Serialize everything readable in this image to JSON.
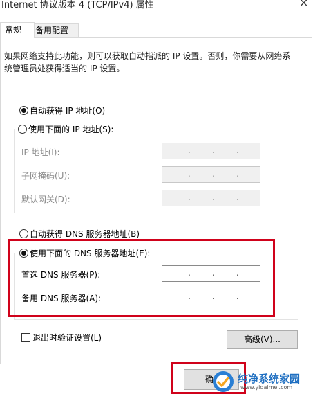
{
  "window": {
    "title": "Internet 协议版本 4 (TCP/IPv4) 属性",
    "close_glyph": "×"
  },
  "tabs": [
    {
      "label": "常规",
      "active": true
    },
    {
      "label": "备用配置",
      "active": false
    }
  ],
  "description": "如果网络支持此功能，则可以获取自动指派的 IP 设置。否则，你需要从网络系统管理员处获得适当的 IP 设置。",
  "ip_section": {
    "auto_label": "自动获得 IP 地址(O)",
    "auto_selected": true,
    "manual_label": "使用下面的 IP 地址(S):",
    "manual_selected": false,
    "fields": [
      {
        "label": "IP 地址(I):",
        "value": ""
      },
      {
        "label": "子网掩码(U):",
        "value": ""
      },
      {
        "label": "默认网关(D):",
        "value": ""
      }
    ]
  },
  "dns_section": {
    "auto_label": "自动获得 DNS 服务器地址(B)",
    "auto_selected": false,
    "manual_label": "使用下面的 DNS 服务器地址(E):",
    "manual_selected": true,
    "fields": [
      {
        "label": "首选 DNS 服务器(P):",
        "value": ""
      },
      {
        "label": "备用 DNS 服务器(A):",
        "value": ""
      }
    ]
  },
  "validate_label": "退出时验证设置(L)",
  "validate_checked": false,
  "advanced_button": "高级(V)...",
  "ok_button_partial": "确",
  "ip_dot": ".",
  "highlight_color": "#d0021b",
  "watermark": {
    "title": "纯净系统家园",
    "url": "www.yidaimei.com"
  }
}
